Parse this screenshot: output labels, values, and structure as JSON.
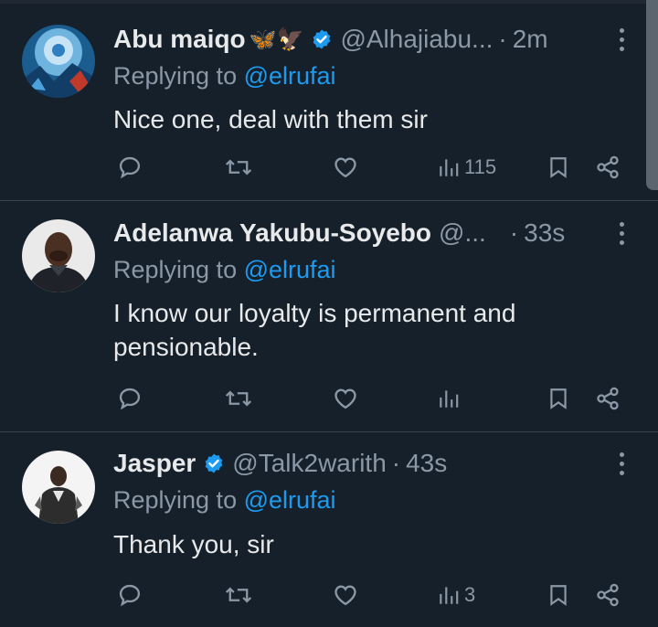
{
  "replies": [
    {
      "name": "Abu maiqo",
      "emoji": "🦋🦅",
      "verified": true,
      "handle": "@Alhajiabu...",
      "dot": "·",
      "time": "2m",
      "replying_prefix": "Replying to ",
      "replying_to": "@elrufai",
      "text": "Nice one, deal with them sir",
      "views": "115"
    },
    {
      "name": "Adelanwa Yakubu-Soyebo",
      "verified": false,
      "handle": "@...",
      "dot": "·",
      "time": "33s",
      "replying_prefix": "Replying to ",
      "replying_to": "@elrufai",
      "text": "I know our loyalty is permanent and pensionable.",
      "views": ""
    },
    {
      "name": "Jasper",
      "verified": true,
      "handle": "@Talk2warith",
      "dot": "·",
      "time": "43s",
      "replying_prefix": "Replying to ",
      "replying_to": "@elrufai",
      "text": "Thank you, sir",
      "views": "3"
    }
  ],
  "icons": {
    "reply": "reply-icon",
    "retweet": "retweet-icon",
    "like": "heart-icon",
    "views": "views-icon",
    "bookmark": "bookmark-icon",
    "share": "share-icon",
    "more": "more-options-icon",
    "verified": "verified-badge-icon"
  },
  "colors": {
    "background": "#15202b",
    "text": "#e7e9ea",
    "secondary": "#8b98a5",
    "accent": "#1d9bf0",
    "divider": "#38444d"
  }
}
